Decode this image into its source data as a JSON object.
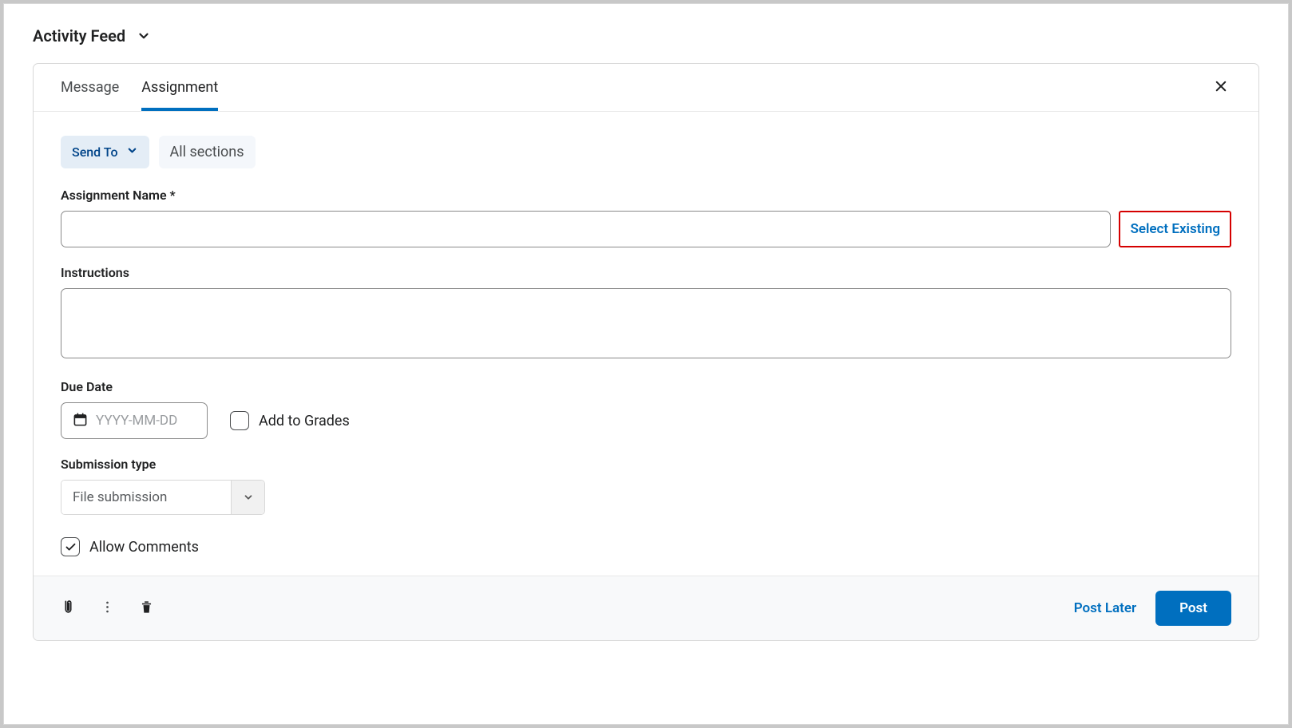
{
  "header": {
    "title": "Activity Feed"
  },
  "tabs": {
    "message": "Message",
    "assignment": "Assignment"
  },
  "recipients": {
    "send_to_label": "Send To",
    "chip_all_sections": "All sections"
  },
  "fields": {
    "assignment_name_label": "Assignment Name *",
    "assignment_name_value": "",
    "select_existing_label": "Select Existing",
    "instructions_label": "Instructions",
    "instructions_value": "",
    "due_date_label": "Due Date",
    "due_date_placeholder": "YYYY-MM-DD",
    "add_to_grades_label": "Add to Grades",
    "submission_type_label": "Submission type",
    "submission_type_value": "File submission",
    "allow_comments_label": "Allow Comments",
    "allow_comments_checked": true
  },
  "footer": {
    "post_later": "Post Later",
    "post": "Post"
  }
}
